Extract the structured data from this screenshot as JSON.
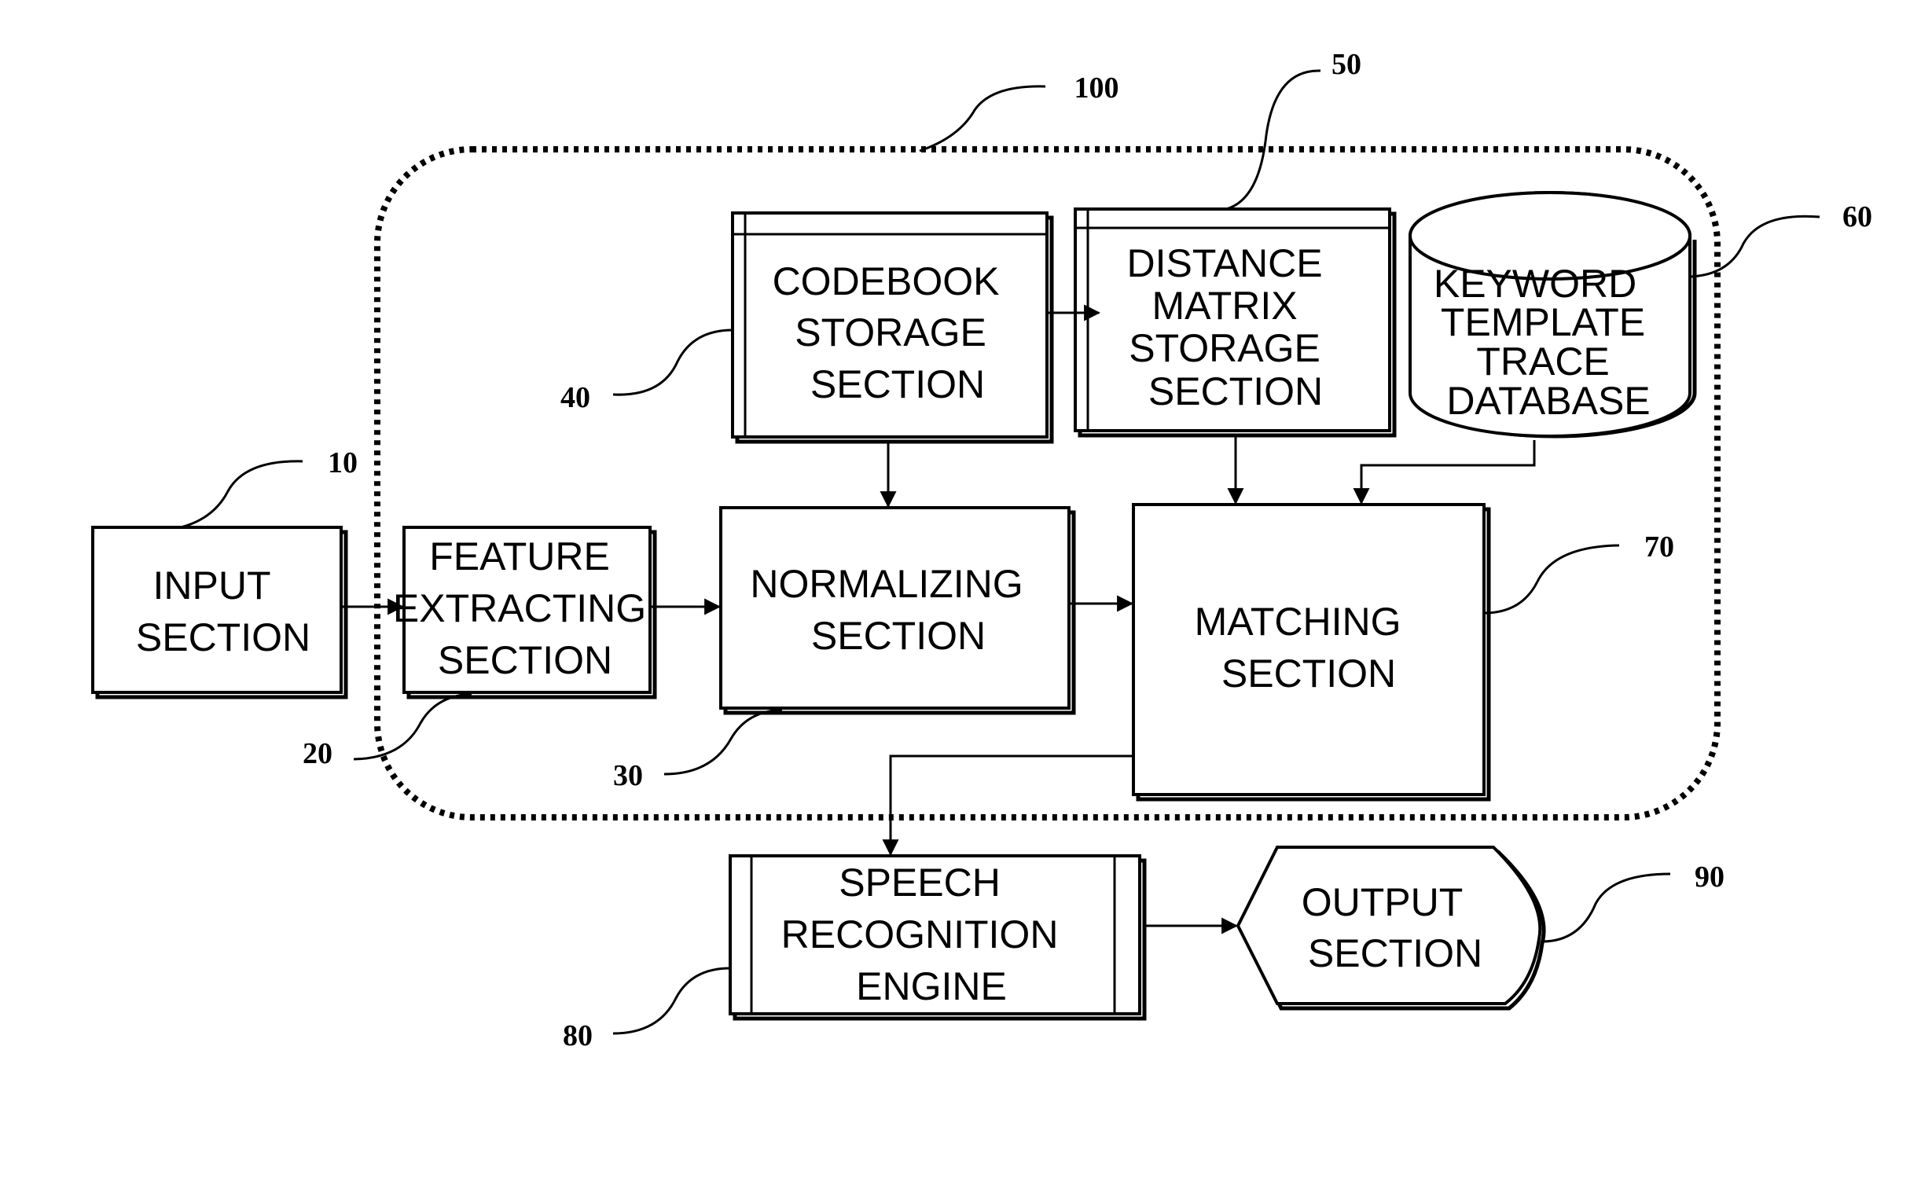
{
  "diagram": {
    "type": "block-diagram",
    "container": {
      "ref": "100"
    },
    "blocks": {
      "input": {
        "ref": "10",
        "lines": [
          "INPUT",
          "SECTION"
        ]
      },
      "feature": {
        "ref": "20",
        "lines": [
          "FEATURE",
          "EXTRACTING",
          "SECTION"
        ]
      },
      "normalizing": {
        "ref": "30",
        "lines": [
          "NORMALIZING",
          "SECTION"
        ]
      },
      "codebook": {
        "ref": "40",
        "lines": [
          "CODEBOOK",
          "STORAGE",
          "SECTION"
        ]
      },
      "distance": {
        "ref": "50",
        "lines": [
          "DISTANCE",
          "MATRIX",
          "STORAGE",
          "SECTION"
        ]
      },
      "keyword_db": {
        "ref": "60",
        "lines": [
          "KEYWORD",
          "TEMPLATE",
          "TRACE",
          "DATABASE"
        ]
      },
      "matching": {
        "ref": "70",
        "lines": [
          "MATCHING",
          "SECTION"
        ]
      },
      "speech": {
        "ref": "80",
        "lines": [
          "SPEECH",
          "RECOGNITION",
          "ENGINE"
        ]
      },
      "output": {
        "ref": "90",
        "lines": [
          "OUTPUT",
          "SECTION"
        ]
      }
    },
    "connections": [
      {
        "from": "input",
        "to": "feature"
      },
      {
        "from": "feature",
        "to": "normalizing"
      },
      {
        "from": "codebook",
        "to": "distance"
      },
      {
        "from": "codebook",
        "to": "normalizing"
      },
      {
        "from": "normalizing",
        "to": "matching"
      },
      {
        "from": "distance",
        "to": "matching"
      },
      {
        "from": "keyword_db",
        "to": "matching"
      },
      {
        "from": "matching",
        "to": "speech"
      },
      {
        "from": "speech",
        "to": "output"
      }
    ]
  }
}
